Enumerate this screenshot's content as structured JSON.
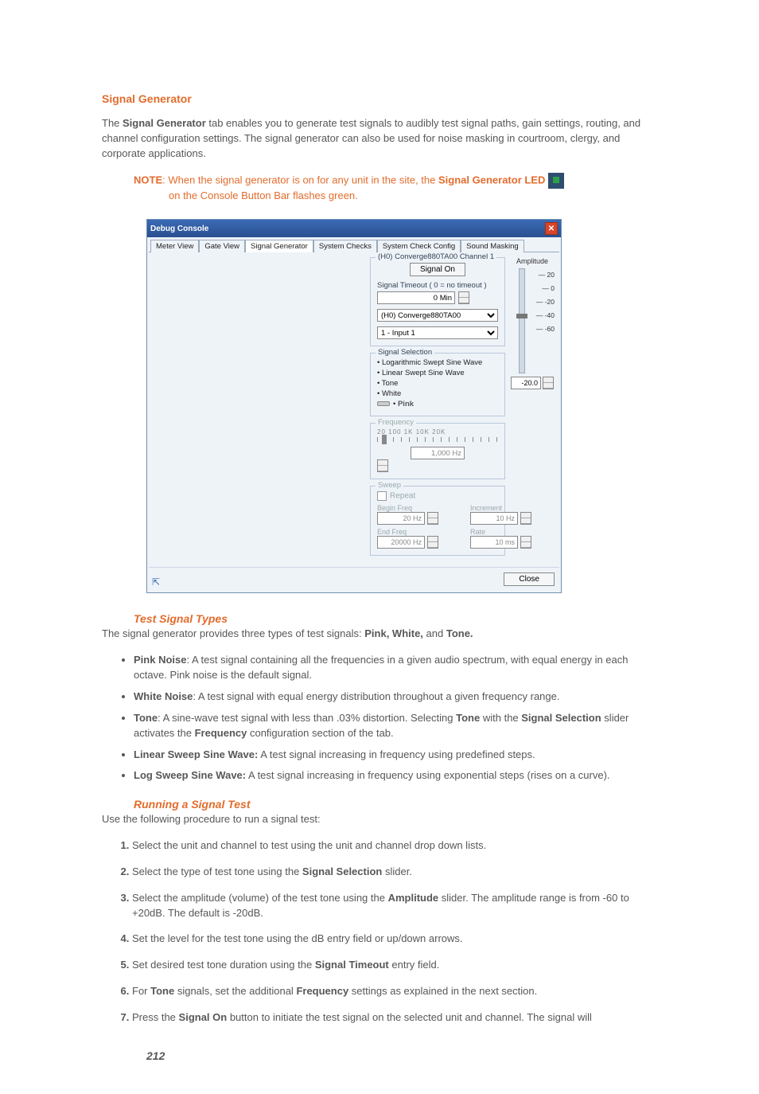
{
  "section_title": "Signal Generator",
  "intro": "The Signal Generator tab enables you to generate test signals to audibly test signal paths, gain settings, routing, and channel configuration settings. The signal generator can also be used for noise masking in courtroom, clergy, and corporate applications.",
  "note": {
    "label": "NOTE",
    "line1_a": ": When the signal generator is on for any unit in the site, the ",
    "sg_led": "Signal Generator LED",
    "line2": "on the Console Button Bar flashes green."
  },
  "dc": {
    "title": "Debug Console",
    "tabs": [
      "Meter View",
      "Gate View",
      "Signal Generator",
      "System Checks",
      "System Check Config",
      "Sound Masking"
    ],
    "header_line": "(H0) Converge880TA00  Channel 1",
    "signal_on": "Signal On",
    "timeout_label": "Signal Timeout  ( 0 = no timeout )",
    "timeout_value": "0 Min",
    "unit_select": "(H0) Converge880TA00",
    "channel_select": "1 - Input 1",
    "sig_sel_title": "Signal Selection",
    "sig_opts": [
      "Logarithmic Swept Sine Wave",
      "Linear Swept Sine Wave",
      "Tone",
      "White",
      "Pink"
    ],
    "freq_title": "Frequency",
    "freq_marks": "20            100             1K              10K        20K",
    "freq_value": "1,000 Hz",
    "sweep_title": "Sweep",
    "repeat": "Repeat",
    "begin_freq_l": "Begin Freq",
    "begin_freq_v": "20 Hz",
    "end_freq_l": "End Freq",
    "end_freq_v": "20000 Hz",
    "increment_l": "Increment",
    "increment_v": "10 Hz",
    "rate_l": "Rate",
    "rate_v": "10 ms",
    "amp_title": "Amplitude",
    "amp_ticks": {
      "a": "— 20",
      "b": "— 0",
      "c": "— -20",
      "d": "— -40",
      "e": "— -60"
    },
    "amp_value": "-20.0",
    "close": "Close"
  },
  "tst": {
    "head": "Test Signal Types",
    "intro": "The signal generator provides three types of test signals: ",
    "pink": "Pink, White,",
    "and": " and ",
    "tone": "Tone.",
    "b1a": "Pink Noise",
    "b1b": ": A test signal containing all the frequencies in a given audio spectrum, with equal energy in each octave. Pink noise is the default signal.",
    "b2a": "White Noise",
    "b2b": ": A test signal with equal energy distribution throughout a given frequency range.",
    "b3a": "Tone",
    "b3b": ": A sine-wave test signal with less than .03% distortion. Selecting ",
    "b3c": "Tone",
    "b3d": " with the ",
    "b3e": "Signal Selection",
    "b3f": " slider activates the ",
    "b3g": "Frequency",
    "b3h": " configuration section of the tab.",
    "b4a": "Linear Sweep Sine Wave:",
    "b4b": " A test signal increasing in frequency using predefined steps.",
    "b5a": "Log Sweep Sine Wave:",
    "b5b": " A test signal increasing in frequency using exponential steps (rises on a curve)."
  },
  "run": {
    "head": "Running a Signal Test",
    "intro": "Use the following procedure to run a signal test:",
    "s1": "Select the unit and channel to test using the unit and channel drop down lists.",
    "s2a": "Select the type of test tone using the ",
    "s2b": "Signal Selection",
    "s2c": " slider.",
    "s3a": "Select the amplitude (volume) of the test tone using the ",
    "s3b": "Amplitude",
    "s3c": " slider. The amplitude range is from -60 to +20dB. The default is -20dB.",
    "s4": "Set the level for the test tone using the dB entry field or up/down arrows.",
    "s5a": "Set desired test tone duration using the ",
    "s5b": "Signal Timeout",
    "s5c": " entry field.",
    "s6a": "For ",
    "s6b": "Tone",
    "s6c": " signals, set the additional ",
    "s6d": "Frequency",
    "s6e": " settings as explained in the next section.",
    "s7a": "Press the ",
    "s7b": "Signal On",
    "s7c": " button to initiate the test signal on the selected unit and channel. The signal will"
  },
  "page_number": "212"
}
